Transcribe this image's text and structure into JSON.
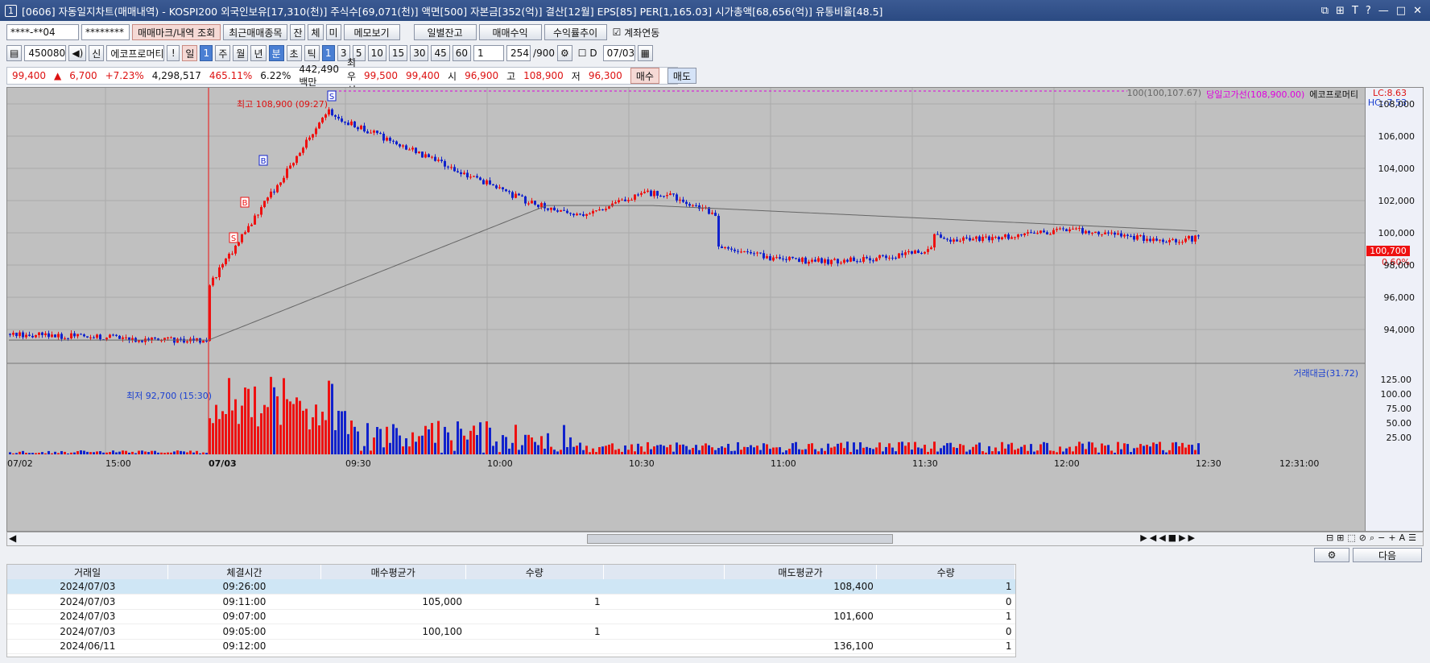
{
  "title": "[0606] 자동일지차트(매매내역) - KOSPI200 외국인보유[17,310(천)] 주식수[69,071(천)] 액면[500] 자본금[352(억)] 결산[12월] EPS[85] PER[1,165.03] 시가총액[68,656(억)] 유통비율[48.5]",
  "window_num": "1",
  "toolbar1": {
    "account": "****-**04",
    "password": "********",
    "btn_mark": "매매마크/내역 조회",
    "btn_recent": "최근매매종목",
    "tabs": [
      "잔",
      "체",
      "미"
    ],
    "btn_memo": "메모보기",
    "btn_daily": "일별잔고",
    "btn_pnl": "매매수익",
    "btn_rate": "수익률추이",
    "chk_link": "계좌연동"
  },
  "toolbar2": {
    "code": "450080",
    "stock_name": "에코프로머티",
    "periods": [
      "주",
      "월",
      "년",
      "분",
      "초",
      "틱"
    ],
    "minute_opts": [
      "1",
      "3",
      "5",
      "10",
      "15",
      "30",
      "45",
      "60"
    ],
    "interval": "1",
    "count": "254",
    "count_max": "/900",
    "date": "07/03",
    "day_label": "일",
    "day_val": "1",
    "flag": "D"
  },
  "quote": {
    "price": "99,400",
    "arrow": "▲",
    "change": "6,700",
    "rate": "+7.23%",
    "volume": "4,298,517",
    "vol_rate": "465.11%",
    "turnover": "6.22%",
    "amount": "442,490백만",
    "priority_label": "최우선",
    "bid1": "99,500",
    "bid2": "99,400",
    "open_label": "시",
    "open": "96,900",
    "high_label": "고",
    "high": "108,900",
    "low_label": "저",
    "low": "96,300",
    "buy": "매수",
    "sell": "매도"
  },
  "chart": {
    "high_note": "최고 108,900 (09:27)",
    "low_note": "최저 92,700 (15:30)",
    "legend_ma": "100(100,107.67)",
    "legend_limit": "당일고가선(108,900.00)",
    "legend_name": "에코프로머티",
    "lc": "LC:8.63",
    "hc": "HC:-7.53",
    "price_tag": "100,700",
    "pct_tag": "0.60%",
    "yticks": [
      "108,000",
      "106,000",
      "104,000",
      "102,000",
      "100,000",
      "98,000",
      "96,000",
      "94,000"
    ],
    "vol_legend": "거래대금(31.72)",
    "vol_ticks": [
      "125.00",
      "100.00",
      "75.00",
      "50.00",
      "25.00"
    ],
    "xticks": [
      "07/02",
      "15:00",
      "07/03",
      "09:30",
      "10:00",
      "10:30",
      "11:00",
      "11:30",
      "12:00",
      "12:30",
      "12:31:00"
    ]
  },
  "chart_data": {
    "type": "candlestick",
    "ylim": [
      92000,
      109500
    ],
    "high": 108900,
    "low": 92700,
    "last": 100700,
    "markers": [
      "S",
      "B",
      "B",
      "S"
    ]
  },
  "grid": {
    "columns": [
      "거래일",
      "체결시간",
      "매수평균가",
      "수량",
      "",
      "매도평균가",
      "수량"
    ],
    "rows": [
      [
        "2024/07/03",
        "09:26:00",
        "",
        "",
        "",
        "108,400",
        "1"
      ],
      [
        "2024/07/03",
        "09:11:00",
        "105,000",
        "1",
        "",
        "",
        "0"
      ],
      [
        "2024/07/03",
        "09:07:00",
        "",
        "",
        "",
        "101,600",
        "1"
      ],
      [
        "2024/07/03",
        "09:05:00",
        "100,100",
        "1",
        "",
        "",
        "0"
      ],
      [
        "2024/06/11",
        "09:12:00",
        "",
        "",
        "",
        "136,100",
        "1"
      ]
    ]
  },
  "next_btn": "다음"
}
